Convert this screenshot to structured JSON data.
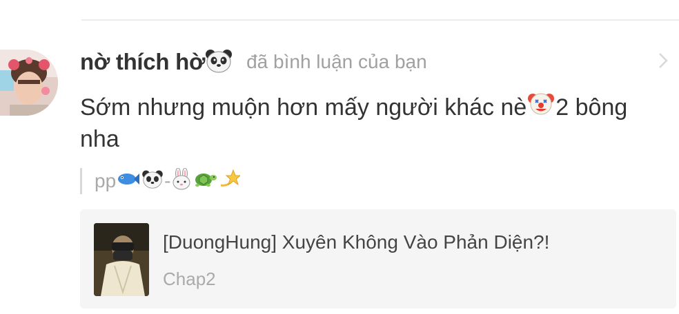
{
  "comment": {
    "username": "nờ thích hờ",
    "username_emoji": "panda-face-icon",
    "action": "đã bình luận của bạn",
    "text_before_emoji": "Sớm nhưng muộn hơn mấy người khác nè",
    "text_emoji": "clown-face-icon",
    "text_after_emoji": "2 bông nha",
    "quote": {
      "prefix": "pp",
      "separator": "-",
      "icons": [
        "fish-icon",
        "panda-face-icon",
        "rabbit-face-icon",
        "turtle-icon",
        "dizzy-star-icon"
      ]
    }
  },
  "story_card": {
    "title": "[DuongHung] Xuyên Không Vào Phản Diện?!",
    "chapter": "Chap2"
  },
  "colors": {
    "username": "#333333",
    "muted": "#a0a0a0",
    "card_bg": "#f5f5f5"
  }
}
